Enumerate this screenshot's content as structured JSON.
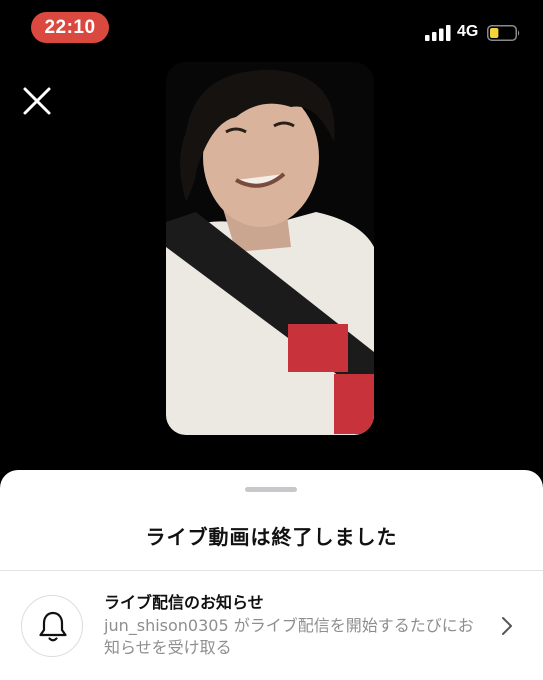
{
  "status_bar": {
    "time": "22:10",
    "network": "4G",
    "time_pill_color": "#d9493f",
    "battery_color": "#f5d33a",
    "battery_level": 0.35,
    "signal_bars": 4
  },
  "close_button": {
    "icon": "close-icon"
  },
  "video": {
    "state": "ended"
  },
  "sheet": {
    "title": "ライブ動画は終了しました",
    "notification": {
      "title": "ライブ配信のお知らせ",
      "description": "jun_shison0305 がライブ配信を開始するたびにお知らせを受け取る",
      "icon": "bell-icon",
      "chevron_icon": "chevron-right-icon"
    }
  }
}
